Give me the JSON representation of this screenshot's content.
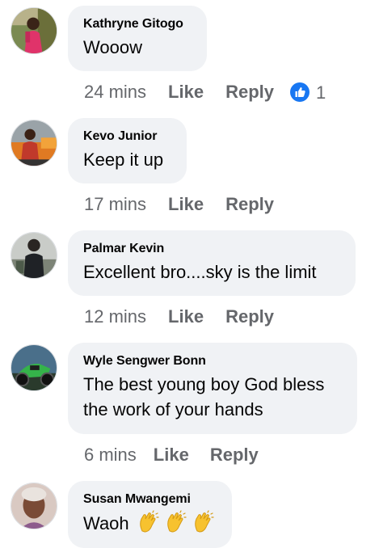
{
  "comments": [
    {
      "author": "Kathryne Gitogo",
      "text": "Wooow",
      "time": "24 mins",
      "like_label": "Like",
      "reply_label": "Reply",
      "reaction_icon": "like-reaction-icon",
      "reaction_count": "1",
      "avatar": "profile-photo-girl-red-dress"
    },
    {
      "author": "Kevo Junior",
      "text": "Keep it up",
      "time": "17 mins",
      "like_label": "Like",
      "reply_label": "Reply",
      "avatar": "profile-photo-man-orange-car"
    },
    {
      "author": "Palmar Kevin",
      "text": "Excellent bro....sky is the limit",
      "time": "12 mins",
      "like_label": "Like",
      "reply_label": "Reply",
      "avatar": "profile-photo-man-dark-outdoor"
    },
    {
      "author": "Wyle Sengwer Bonn",
      "text_line1": "The best young boy God bless",
      "text_line2": "the work of your hands",
      "time": "6 mins",
      "like_label": "Like",
      "reply_label": "Reply",
      "avatar": "profile-photo-green-motorcycle"
    },
    {
      "author": "Susan Mwangemi",
      "text": "Waoh",
      "emoji": [
        "clapping-hands-icon",
        "clapping-hands-icon",
        "clapping-hands-icon"
      ],
      "avatar": "profile-photo-woman-portrait"
    }
  ],
  "colors": {
    "bubble_bg": "#f0f2f5",
    "meta_text": "#65676b",
    "primary_text": "#050505",
    "like_blue": "#1877f2"
  }
}
